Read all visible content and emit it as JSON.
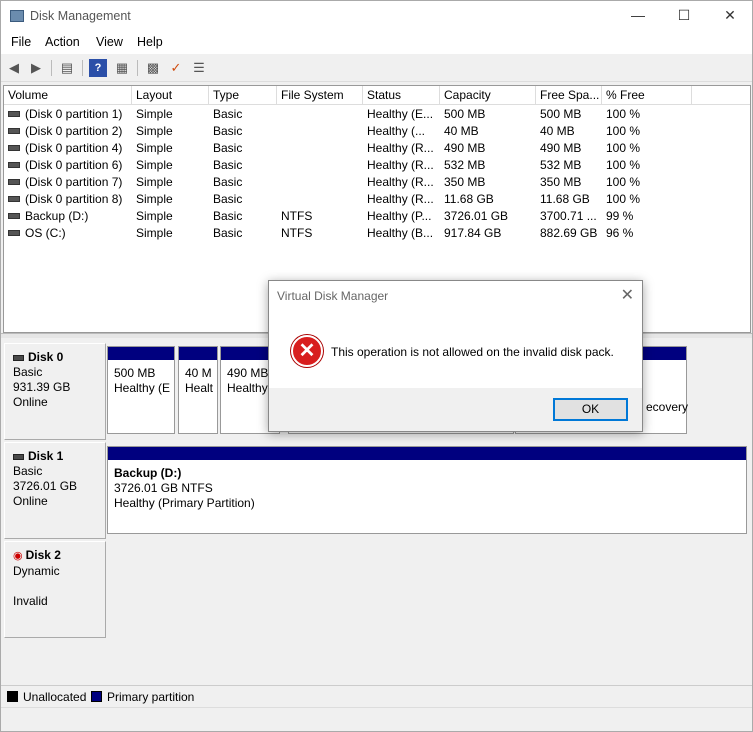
{
  "window": {
    "title": "Disk Management"
  },
  "menu": [
    "File",
    "Action",
    "View",
    "Help"
  ],
  "columns": [
    "Volume",
    "Layout",
    "Type",
    "File System",
    "Status",
    "Capacity",
    "Free Spa...",
    "% Free"
  ],
  "volumes": [
    {
      "volume": "(Disk 0 partition 1)",
      "layout": "Simple",
      "type": "Basic",
      "fs": "",
      "status": "Healthy (E...",
      "capacity": "500 MB",
      "free": "500 MB",
      "pct": "100 %"
    },
    {
      "volume": "(Disk 0 partition 2)",
      "layout": "Simple",
      "type": "Basic",
      "fs": "",
      "status": "Healthy (...",
      "capacity": "40 MB",
      "free": "40 MB",
      "pct": "100 %"
    },
    {
      "volume": "(Disk 0 partition 4)",
      "layout": "Simple",
      "type": "Basic",
      "fs": "",
      "status": "Healthy (R...",
      "capacity": "490 MB",
      "free": "490 MB",
      "pct": "100 %"
    },
    {
      "volume": "(Disk 0 partition 6)",
      "layout": "Simple",
      "type": "Basic",
      "fs": "",
      "status": "Healthy (R...",
      "capacity": "532 MB",
      "free": "532 MB",
      "pct": "100 %"
    },
    {
      "volume": "(Disk 0 partition 7)",
      "layout": "Simple",
      "type": "Basic",
      "fs": "",
      "status": "Healthy (R...",
      "capacity": "350 MB",
      "free": "350 MB",
      "pct": "100 %"
    },
    {
      "volume": "(Disk 0 partition 8)",
      "layout": "Simple",
      "type": "Basic",
      "fs": "",
      "status": "Healthy (R...",
      "capacity": "11.68 GB",
      "free": "11.68 GB",
      "pct": "100 %"
    },
    {
      "volume": "Backup (D:)",
      "layout": "Simple",
      "type": "Basic",
      "fs": "NTFS",
      "status": "Healthy (P...",
      "capacity": "3726.01 GB",
      "free": "3700.71 ...",
      "pct": "99 %"
    },
    {
      "volume": "OS (C:)",
      "layout": "Simple",
      "type": "Basic",
      "fs": "NTFS",
      "status": "Healthy (B...",
      "capacity": "917.84 GB",
      "free": "882.69 GB",
      "pct": "96 %"
    }
  ],
  "disks": {
    "disk0": {
      "name": "Disk 0",
      "type": "Basic",
      "size": "931.39 GB",
      "state": "Online",
      "partitions": [
        {
          "line1": "500 MB",
          "line2": "Healthy (E"
        },
        {
          "line1": "40 M",
          "line2": "Healt"
        },
        {
          "line1": "490 MB",
          "line2": "Healthy"
        }
      ],
      "recovery_fragment": "ecovery"
    },
    "disk1": {
      "name": "Disk 1",
      "type": "Basic",
      "size": "3726.01 GB",
      "state": "Online",
      "partition": {
        "label": "Backup  (D:)",
        "size": "3726.01 GB NTFS",
        "status": "Healthy (Primary Partition)"
      }
    },
    "disk2": {
      "name": "Disk 2",
      "type": "Dynamic",
      "state": "Invalid"
    }
  },
  "legend": {
    "unallocated": "Unallocated",
    "primary": "Primary partition"
  },
  "colors": {
    "primary": "#00007f",
    "unallocated": "#000000",
    "error": "#d81e1e"
  },
  "dialog": {
    "title": "Virtual Disk Manager",
    "message": "This operation is not allowed on the invalid disk pack.",
    "ok_label": "OK"
  }
}
